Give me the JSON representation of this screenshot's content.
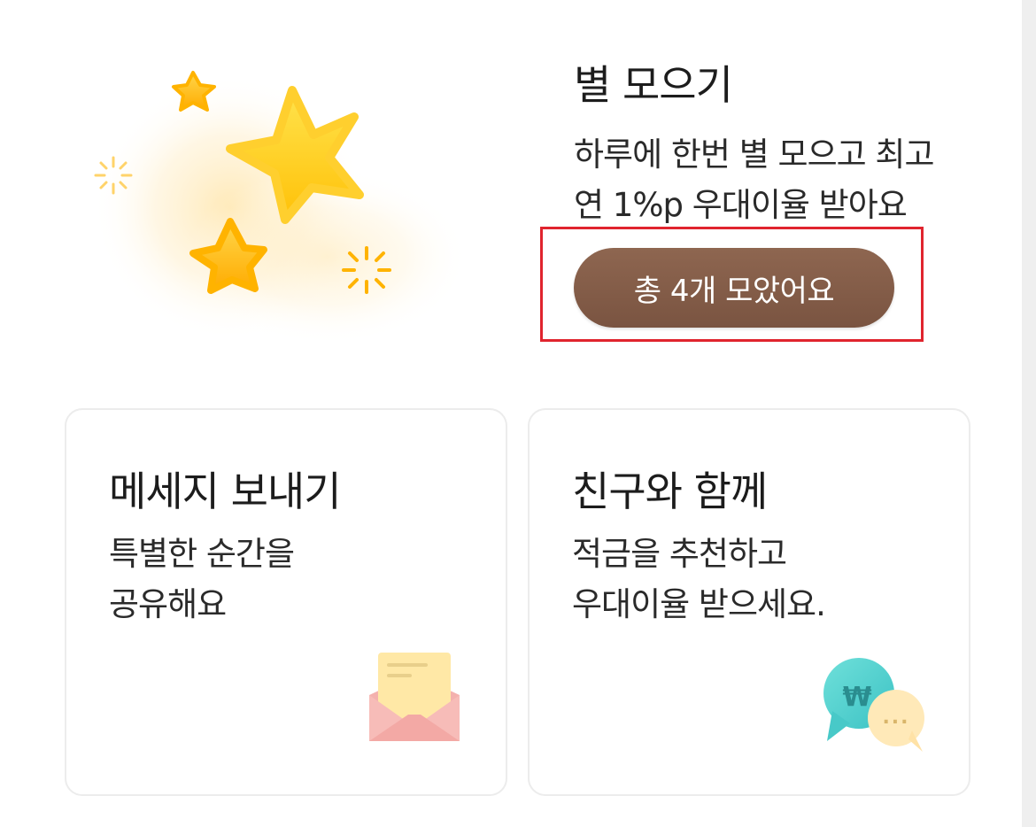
{
  "star_section": {
    "title": "별 모으기",
    "desc_line1": "하루에 한번 별 모으고 최고",
    "desc_line2": "연 1%p 우대이율 받아요",
    "button_label": "총 4개 모았어요",
    "button_color": "#81594a",
    "highlight_color": "#e0242e",
    "illustration": "stars-illustration"
  },
  "cards": {
    "message": {
      "title": "메세지 보내기",
      "desc_line1": "특별한 순간을",
      "desc_line2": "공유해요",
      "icon": "envelope-letter-icon"
    },
    "friend": {
      "title": "친구와 함께",
      "desc_line1": "적금을 추천하고",
      "desc_line2": "우대이율 받으세요.",
      "icon": "chat-bubbles-won-icon",
      "icon_glyph": "₩",
      "icon_dots": "..."
    }
  }
}
